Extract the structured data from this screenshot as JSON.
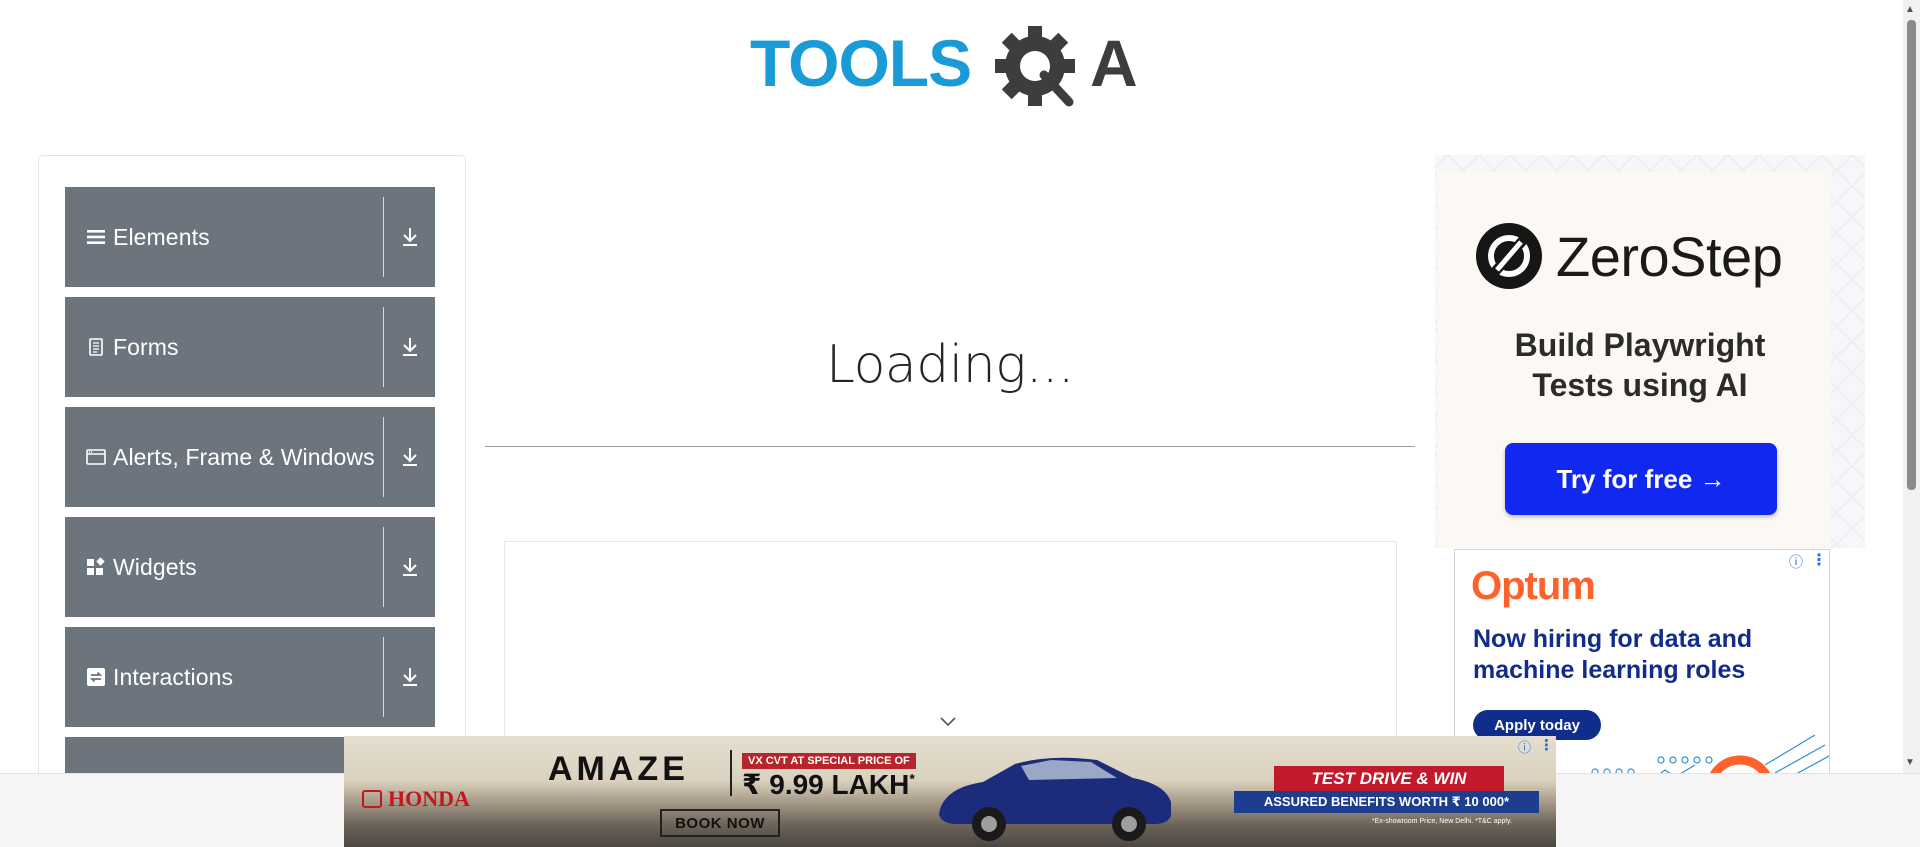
{
  "header": {
    "logo_text_left": "TOOLS",
    "logo_text_right": "A"
  },
  "sidebar": {
    "groups": [
      {
        "label": "Elements",
        "icon": "hamburger-icon"
      },
      {
        "label": "Forms",
        "icon": "document-icon"
      },
      {
        "label": "Alerts, Frame & Windows",
        "icon": "window-icon"
      },
      {
        "label": "Widgets",
        "icon": "widgets-icon"
      },
      {
        "label": "Interactions",
        "icon": "interactions-icon"
      }
    ]
  },
  "main": {
    "loading_text": "Loading..."
  },
  "ads": {
    "zerostep": {
      "brand": "ZeroStep",
      "tagline_line1": "Build Playwright",
      "tagline_line2": "Tests using AI",
      "cta": "Try for free →"
    },
    "optum": {
      "brand": "Optum",
      "headline": "Now hiring for data and machine learning roles",
      "cta": "Apply today",
      "info": "ⓘ",
      "more": "⋮"
    },
    "honda": {
      "brand": "HONDA",
      "model": "AMAZE",
      "offer_tag": "VX CVT AT SPECIAL PRICE OF",
      "price": "₹ 9.99 LAKH",
      "price_suffix": "*",
      "book": "BOOK NOW",
      "test_drive": "TEST DRIVE & WIN",
      "benefits": "ASSURED BENEFITS WORTH ₹ 10 000*",
      "disclaimer": "*Ex-showroom Price, New Delhi. *T&C apply.",
      "info": "ⓘ",
      "more": "⋮"
    }
  },
  "colors": {
    "accent_blue": "#1a9ad6",
    "logo_dark": "#3d3d3d",
    "sidebar_bg": "#6c757d",
    "cta_blue": "#1028f0",
    "optum_orange": "#ff612b"
  }
}
